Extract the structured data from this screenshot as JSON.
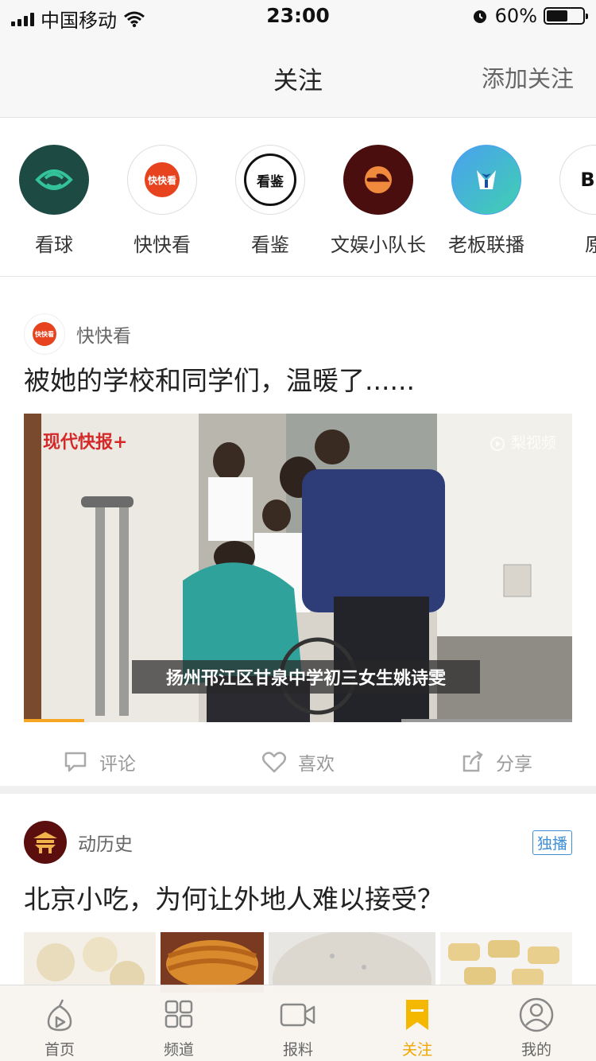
{
  "status_bar": {
    "carrier": "中国移动",
    "time": "23:00",
    "battery": "60%",
    "battery_level": 0.6
  },
  "header": {
    "title": "关注",
    "add_follow": "添加关注"
  },
  "subscriptions": [
    {
      "label": "看球",
      "icon": "kanqiu-logo-icon"
    },
    {
      "label": "快快看",
      "icon": "kuaikuaikan-logo-icon",
      "logo_text": "快快看"
    },
    {
      "label": "看鉴",
      "icon": "kanjian-logo-icon",
      "logo_text": "看鉴"
    },
    {
      "label": "文娱小队长",
      "icon": "wenyu-logo-icon"
    },
    {
      "label": "老板联播",
      "icon": "laoban-logo-icon"
    },
    {
      "label": "原",
      "icon": "brand-logo-icon",
      "logo_text": "Bru"
    }
  ],
  "posts": [
    {
      "author": "快快看",
      "author_logo_text": "快快看",
      "title": "被她的学校和同学们，温暖了......",
      "video": {
        "brand_text": "现代快报+",
        "watermark": "梨视频",
        "caption": "扬州邗江区甘泉中学初三女生姚诗雯",
        "progress": 0.11
      },
      "actions": {
        "comment": "评论",
        "like": "喜欢",
        "share": "分享"
      }
    },
    {
      "author": "动历史",
      "badge": "独播",
      "title": "北京小吃，为何让外地人难以接受？"
    }
  ],
  "tabbar": [
    {
      "label": "首页",
      "icon": "home-icon"
    },
    {
      "label": "频道",
      "icon": "channel-grid-icon"
    },
    {
      "label": "报料",
      "icon": "video-camera-icon"
    },
    {
      "label": "关注",
      "icon": "bookmark-icon",
      "active": true
    },
    {
      "label": "我的",
      "icon": "profile-icon"
    }
  ],
  "colors": {
    "accent": "#f0a500",
    "badge_blue": "#3e8fd8",
    "brand_red": "#d52929"
  }
}
